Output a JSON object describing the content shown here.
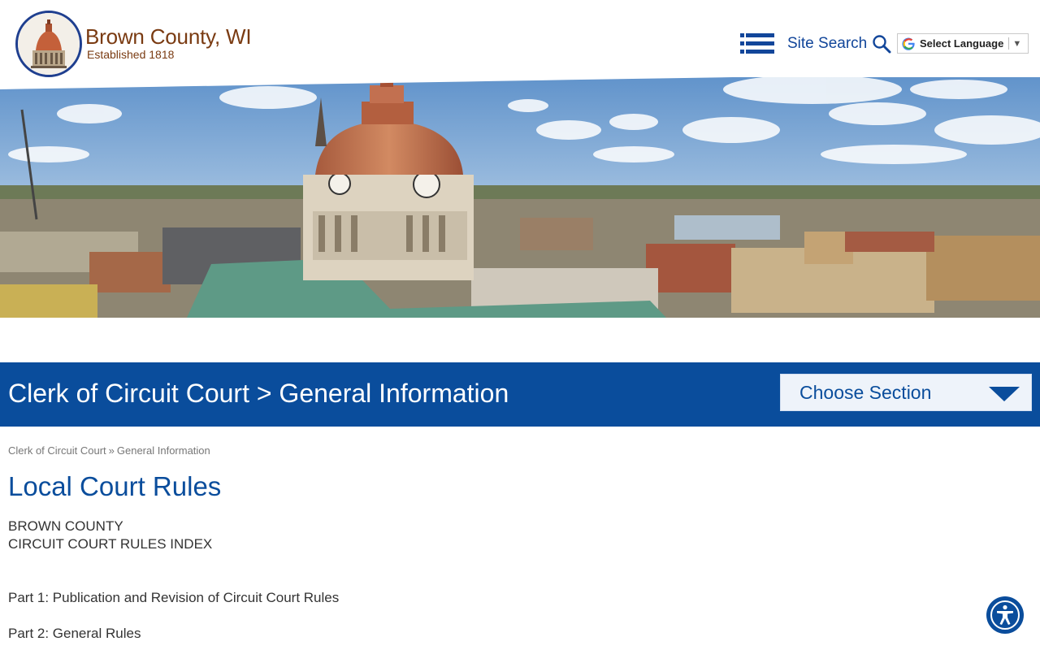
{
  "header": {
    "site_name": "Brown County, WI",
    "tagline": "Established 1818",
    "search_label": "Site Search",
    "language_label": "Select Language",
    "language_arrow": "▼"
  },
  "hero": {},
  "title_bar": {
    "heading": "Clerk of Circuit Court > General Information",
    "choose_section": "Choose Section"
  },
  "breadcrumb": {
    "items": [
      "Clerk of Circuit Court",
      "General Information"
    ],
    "separator": "»"
  },
  "content": {
    "title": "Local Court Rules",
    "lines": [
      "BROWN COUNTY",
      "CIRCUIT COURT RULES INDEX"
    ],
    "parts": [
      "Part 1: Publication and Revision of Circuit Court Rules",
      "Part 2: General Rules"
    ]
  },
  "colors": {
    "brand_blue": "#0a4d9c",
    "brand_brown": "#7a3b12",
    "text": "#333333"
  },
  "icons": {
    "menu": "hamburger-menu-icon",
    "search": "search-icon",
    "language": "google-translate-icon",
    "chevron": "chevron-down-icon",
    "accessibility": "accessibility-icon"
  }
}
